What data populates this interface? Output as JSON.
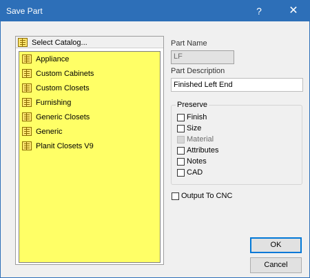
{
  "window": {
    "title": "Save Part",
    "help_glyph": "?",
    "close_glyph": "✕"
  },
  "catalog": {
    "header": "Select Catalog...",
    "items": [
      {
        "label": "Appliance"
      },
      {
        "label": "Custom Cabinets"
      },
      {
        "label": "Custom Closets"
      },
      {
        "label": "Furnishing"
      },
      {
        "label": "Generic Closets"
      },
      {
        "label": "Generic"
      },
      {
        "label": "Planit Closets V9"
      }
    ],
    "highlight_color": "#ffff66"
  },
  "part_name": {
    "label": "Part Name",
    "value": "LF"
  },
  "part_description": {
    "label": "Part Description",
    "value": "Finished Left End"
  },
  "preserve": {
    "legend": "Preserve",
    "options": [
      {
        "label": "Finish",
        "checked": false,
        "enabled": true
      },
      {
        "label": "Size",
        "checked": false,
        "enabled": true
      },
      {
        "label": "Material",
        "checked": false,
        "enabled": false
      },
      {
        "label": "Attributes",
        "checked": false,
        "enabled": true
      },
      {
        "label": "Notes",
        "checked": false,
        "enabled": true
      },
      {
        "label": "CAD",
        "checked": false,
        "enabled": true
      }
    ]
  },
  "output_to_cnc": {
    "label": "Output To CNC",
    "checked": false
  },
  "buttons": {
    "ok": "OK",
    "cancel": "Cancel"
  }
}
